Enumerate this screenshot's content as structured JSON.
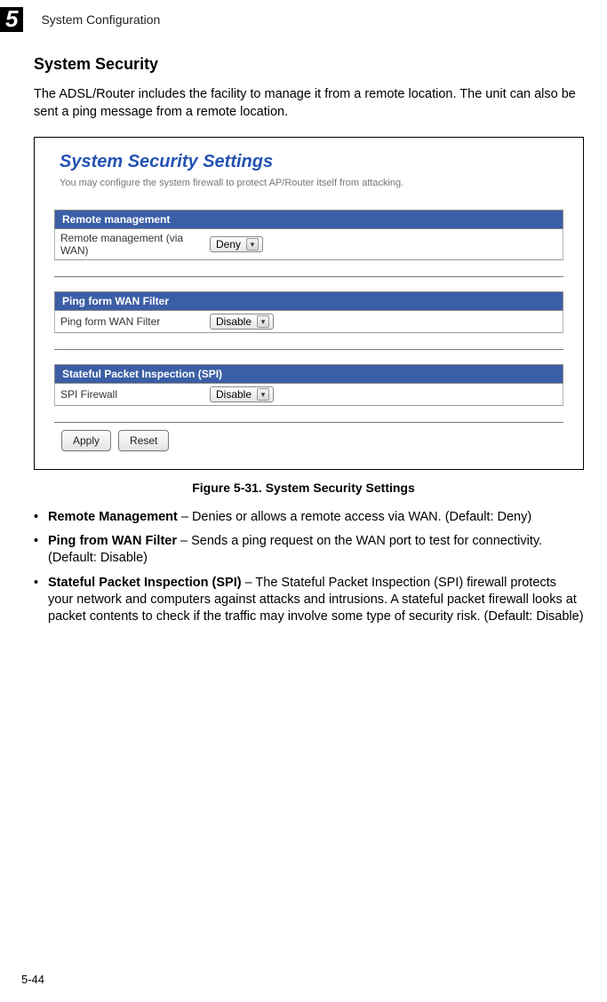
{
  "header": {
    "chapter_num": "5",
    "chapter_title": "System Configuration"
  },
  "section_heading": "System Security",
  "intro": "The ADSL/Router includes the facility to manage it from a remote location. The unit can also be sent a ping message from a remote location.",
  "screenshot": {
    "title": "System Security Settings",
    "subtext": "You may configure the system firewall to protect AP/Router itself from attacking.",
    "sections": [
      {
        "header": "Remote management",
        "row_label": "Remote management (via WAN)",
        "select_value": "Deny"
      },
      {
        "header": "Ping form WAN Filter",
        "row_label": "Ping form WAN Filter",
        "select_value": "Disable"
      },
      {
        "header": "Stateful Packet Inspection (SPI)",
        "row_label": "SPI Firewall",
        "select_value": "Disable"
      }
    ],
    "buttons": {
      "apply": "Apply",
      "reset": "Reset"
    }
  },
  "figure_caption": "Figure 5-31.   System Security Settings",
  "bullets": [
    {
      "lead": "Remote Management",
      "rest": " – Denies or allows a remote access via WAN. (Default: Deny)"
    },
    {
      "lead": "Ping from WAN Filter",
      "rest": " – Sends a ping request on the WAN port to test for connectivity. (Default: Disable)"
    },
    {
      "lead": "Stateful Packet Inspection (SPI)",
      "rest": " – The Stateful Packet Inspection (SPI) firewall protects your network and computers against attacks and intrusions. A stateful packet firewall looks at packet contents to check if the traffic may involve some type of security risk. (Default: Disable)"
    }
  ],
  "page_num": "5-44"
}
